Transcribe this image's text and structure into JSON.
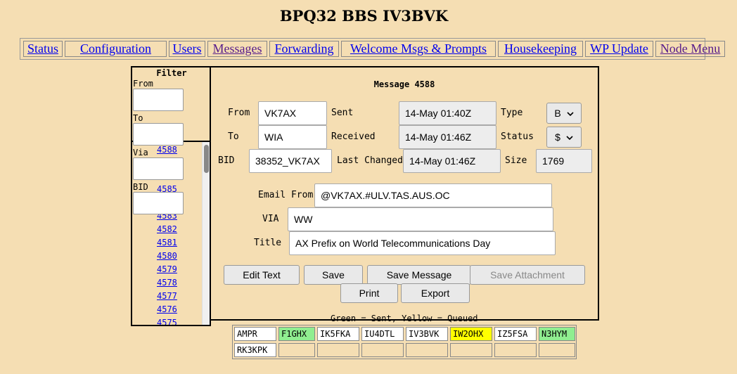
{
  "page_title": "BPQ32 BBS IV3BVK",
  "menu": [
    {
      "label": "Status",
      "visited": false
    },
    {
      "label": "Configuration",
      "visited": false
    },
    {
      "label": "Users",
      "visited": false
    },
    {
      "label": "Messages",
      "visited": true
    },
    {
      "label": "Forwarding",
      "visited": false
    },
    {
      "label": "Welcome Msgs & Prompts",
      "visited": false
    },
    {
      "label": "Housekeeping",
      "visited": false
    },
    {
      "label": "WP Update",
      "visited": false
    },
    {
      "label": "Node Menu",
      "visited": true
    }
  ],
  "filter": {
    "title": "Filter",
    "from_label": "From",
    "to_label": "To",
    "via_label": "Via",
    "bid_label": "BID",
    "from_value": "",
    "to_value": "",
    "via_value": "",
    "bid_value": ""
  },
  "message_list": [
    "4588",
    "4585",
    "4583",
    "4582",
    "4581",
    "4580",
    "4579",
    "4578",
    "4577",
    "4576",
    "4575"
  ],
  "message": {
    "heading": "Message 4588",
    "from_label": "From",
    "from": "VK7AX",
    "to_label": "To",
    "to": "WIA",
    "bid_label": "BID",
    "bid": "38352_VK7AX",
    "sent_label": "Sent",
    "sent": "14-May 01:40Z",
    "received_label": "Received",
    "received": "14-May 01:46Z",
    "last_changed_label": "Last Changed",
    "last_changed": "14-May 01:46Z",
    "type_label": "Type",
    "type": "B",
    "status_label": "Status",
    "status": "$",
    "size_label": "Size",
    "size": "1769",
    "email_from_label": "Email From",
    "email_from": "@VK7AX.#ULV.TAS.AUS.OC",
    "via_label": "VIA",
    "via": "WW",
    "title_label": "Title",
    "title": "AX Prefix on World Telecommunications Day"
  },
  "buttons": {
    "edit_text": "Edit Text",
    "save": "Save",
    "save_message": "Save Message",
    "save_attachment": "Save Attachment",
    "print": "Print",
    "export": "Export"
  },
  "legend": "Green = Sent, Yellow = Queued",
  "stations": [
    {
      "call": "AMPR",
      "color": "#ffffff"
    },
    {
      "call": "F1GHX",
      "color": "#90ee90"
    },
    {
      "call": "IK5FKA",
      "color": "#ffffff"
    },
    {
      "call": "IU4DTL",
      "color": "#ffffff"
    },
    {
      "call": "IV3BVK",
      "color": "#ffffff"
    },
    {
      "call": "IW2OHX",
      "color": "#ffff00"
    },
    {
      "call": "IZ5FSA",
      "color": "#ffffff"
    },
    {
      "call": "N3HYM",
      "color": "#90ee90"
    },
    {
      "call": "RK3KPK",
      "color": "#ffffff"
    },
    {
      "call": "",
      "color": ""
    },
    {
      "call": "",
      "color": ""
    },
    {
      "call": "",
      "color": ""
    },
    {
      "call": "",
      "color": ""
    },
    {
      "call": "",
      "color": ""
    },
    {
      "call": "",
      "color": ""
    },
    {
      "call": "",
      "color": ""
    }
  ]
}
